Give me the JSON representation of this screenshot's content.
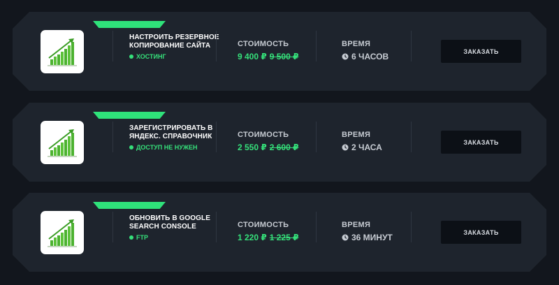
{
  "services": [
    {
      "title": "Настроить резервное копирование сайта",
      "tag": "Хостинг",
      "cost_label": "Стоимость",
      "price": "9 400 ₽",
      "old_price": "9 500 ₽",
      "time_label": "Время",
      "time": "6 часов",
      "button_label": "Заказать",
      "icon": "growth-chart-icon"
    },
    {
      "title": "Зарегистрировать в Яндекс. Справочник",
      "tag": "Доступ не нужен",
      "cost_label": "Стоимость",
      "price": "2 550 ₽",
      "old_price": "2 600 ₽",
      "time_label": "Время",
      "time": "2 часа",
      "button_label": "Заказать",
      "icon": "growth-chart-icon"
    },
    {
      "title": "Обновить в Google Search Console",
      "tag": "FTP",
      "cost_label": "Стоимость",
      "price": "1 220 ₽",
      "old_price": "1 225 ₽",
      "time_label": "Время",
      "time": "36 минут",
      "button_label": "Заказать",
      "icon": "growth-chart-icon"
    }
  ],
  "colors": {
    "background": "#12161d",
    "card": "#1e242d",
    "accent": "#2fe27a",
    "button": "#0c1016"
  }
}
